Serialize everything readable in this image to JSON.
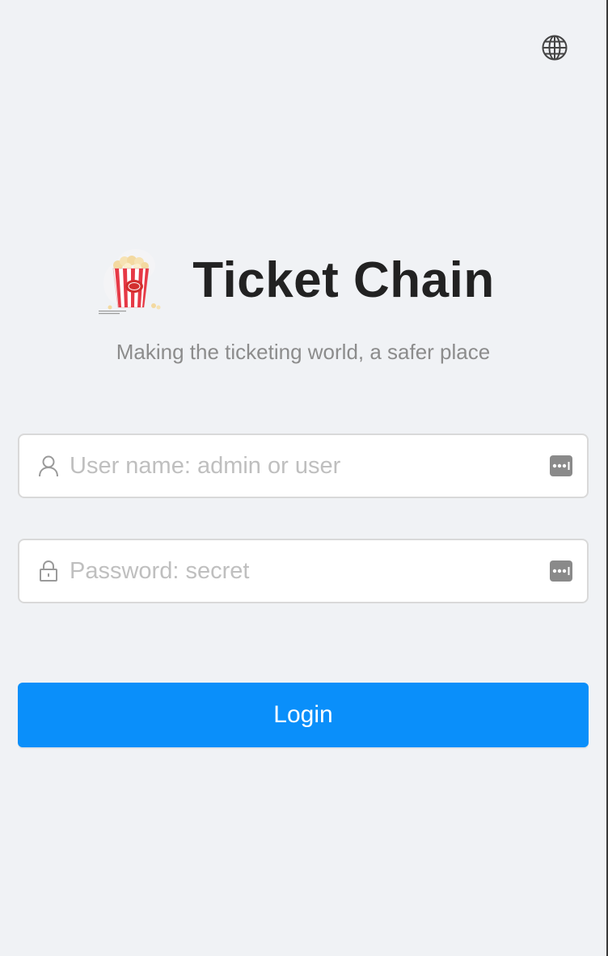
{
  "header": {
    "language_icon": "globe-icon"
  },
  "brand": {
    "logo_icon": "popcorn-logo-icon",
    "title": "Ticket Chain",
    "tagline": "Making the ticketing world, a safer place"
  },
  "form": {
    "username": {
      "placeholder": "User name: admin or user",
      "value": "",
      "prefix_icon": "user-icon",
      "suffix_icon": "password-manager-icon"
    },
    "password": {
      "placeholder": "Password: secret",
      "value": "",
      "prefix_icon": "lock-icon",
      "suffix_icon": "password-manager-icon"
    },
    "login_label": "Login"
  },
  "colors": {
    "background": "#f0f2f5",
    "primary": "#0a8ffa",
    "title": "#222222",
    "tagline": "#8c8c8c",
    "placeholder": "#bfbfbf"
  }
}
